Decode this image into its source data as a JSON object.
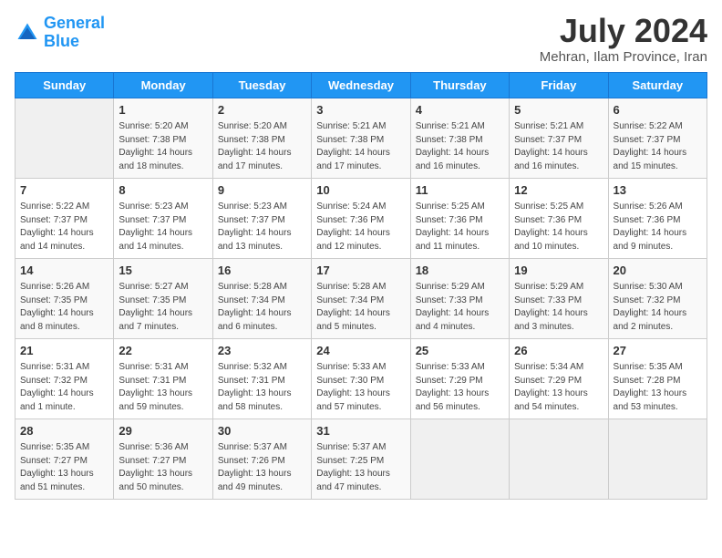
{
  "header": {
    "logo_line1": "General",
    "logo_line2": "Blue",
    "month_year": "July 2024",
    "location": "Mehran, Ilam Province, Iran"
  },
  "days_of_week": [
    "Sunday",
    "Monday",
    "Tuesday",
    "Wednesday",
    "Thursday",
    "Friday",
    "Saturday"
  ],
  "weeks": [
    [
      {
        "day": "",
        "content": ""
      },
      {
        "day": "1",
        "content": "Sunrise: 5:20 AM\nSunset: 7:38 PM\nDaylight: 14 hours\nand 18 minutes."
      },
      {
        "day": "2",
        "content": "Sunrise: 5:20 AM\nSunset: 7:38 PM\nDaylight: 14 hours\nand 17 minutes."
      },
      {
        "day": "3",
        "content": "Sunrise: 5:21 AM\nSunset: 7:38 PM\nDaylight: 14 hours\nand 17 minutes."
      },
      {
        "day": "4",
        "content": "Sunrise: 5:21 AM\nSunset: 7:38 PM\nDaylight: 14 hours\nand 16 minutes."
      },
      {
        "day": "5",
        "content": "Sunrise: 5:21 AM\nSunset: 7:37 PM\nDaylight: 14 hours\nand 16 minutes."
      },
      {
        "day": "6",
        "content": "Sunrise: 5:22 AM\nSunset: 7:37 PM\nDaylight: 14 hours\nand 15 minutes."
      }
    ],
    [
      {
        "day": "7",
        "content": "Sunrise: 5:22 AM\nSunset: 7:37 PM\nDaylight: 14 hours\nand 14 minutes."
      },
      {
        "day": "8",
        "content": "Sunrise: 5:23 AM\nSunset: 7:37 PM\nDaylight: 14 hours\nand 14 minutes."
      },
      {
        "day": "9",
        "content": "Sunrise: 5:23 AM\nSunset: 7:37 PM\nDaylight: 14 hours\nand 13 minutes."
      },
      {
        "day": "10",
        "content": "Sunrise: 5:24 AM\nSunset: 7:36 PM\nDaylight: 14 hours\nand 12 minutes."
      },
      {
        "day": "11",
        "content": "Sunrise: 5:25 AM\nSunset: 7:36 PM\nDaylight: 14 hours\nand 11 minutes."
      },
      {
        "day": "12",
        "content": "Sunrise: 5:25 AM\nSunset: 7:36 PM\nDaylight: 14 hours\nand 10 minutes."
      },
      {
        "day": "13",
        "content": "Sunrise: 5:26 AM\nSunset: 7:36 PM\nDaylight: 14 hours\nand 9 minutes."
      }
    ],
    [
      {
        "day": "14",
        "content": "Sunrise: 5:26 AM\nSunset: 7:35 PM\nDaylight: 14 hours\nand 8 minutes."
      },
      {
        "day": "15",
        "content": "Sunrise: 5:27 AM\nSunset: 7:35 PM\nDaylight: 14 hours\nand 7 minutes."
      },
      {
        "day": "16",
        "content": "Sunrise: 5:28 AM\nSunset: 7:34 PM\nDaylight: 14 hours\nand 6 minutes."
      },
      {
        "day": "17",
        "content": "Sunrise: 5:28 AM\nSunset: 7:34 PM\nDaylight: 14 hours\nand 5 minutes."
      },
      {
        "day": "18",
        "content": "Sunrise: 5:29 AM\nSunset: 7:33 PM\nDaylight: 14 hours\nand 4 minutes."
      },
      {
        "day": "19",
        "content": "Sunrise: 5:29 AM\nSunset: 7:33 PM\nDaylight: 14 hours\nand 3 minutes."
      },
      {
        "day": "20",
        "content": "Sunrise: 5:30 AM\nSunset: 7:32 PM\nDaylight: 14 hours\nand 2 minutes."
      }
    ],
    [
      {
        "day": "21",
        "content": "Sunrise: 5:31 AM\nSunset: 7:32 PM\nDaylight: 14 hours\nand 1 minute."
      },
      {
        "day": "22",
        "content": "Sunrise: 5:31 AM\nSunset: 7:31 PM\nDaylight: 13 hours\nand 59 minutes."
      },
      {
        "day": "23",
        "content": "Sunrise: 5:32 AM\nSunset: 7:31 PM\nDaylight: 13 hours\nand 58 minutes."
      },
      {
        "day": "24",
        "content": "Sunrise: 5:33 AM\nSunset: 7:30 PM\nDaylight: 13 hours\nand 57 minutes."
      },
      {
        "day": "25",
        "content": "Sunrise: 5:33 AM\nSunset: 7:29 PM\nDaylight: 13 hours\nand 56 minutes."
      },
      {
        "day": "26",
        "content": "Sunrise: 5:34 AM\nSunset: 7:29 PM\nDaylight: 13 hours\nand 54 minutes."
      },
      {
        "day": "27",
        "content": "Sunrise: 5:35 AM\nSunset: 7:28 PM\nDaylight: 13 hours\nand 53 minutes."
      }
    ],
    [
      {
        "day": "28",
        "content": "Sunrise: 5:35 AM\nSunset: 7:27 PM\nDaylight: 13 hours\nand 51 minutes."
      },
      {
        "day": "29",
        "content": "Sunrise: 5:36 AM\nSunset: 7:27 PM\nDaylight: 13 hours\nand 50 minutes."
      },
      {
        "day": "30",
        "content": "Sunrise: 5:37 AM\nSunset: 7:26 PM\nDaylight: 13 hours\nand 49 minutes."
      },
      {
        "day": "31",
        "content": "Sunrise: 5:37 AM\nSunset: 7:25 PM\nDaylight: 13 hours\nand 47 minutes."
      },
      {
        "day": "",
        "content": ""
      },
      {
        "day": "",
        "content": ""
      },
      {
        "day": "",
        "content": ""
      }
    ]
  ]
}
